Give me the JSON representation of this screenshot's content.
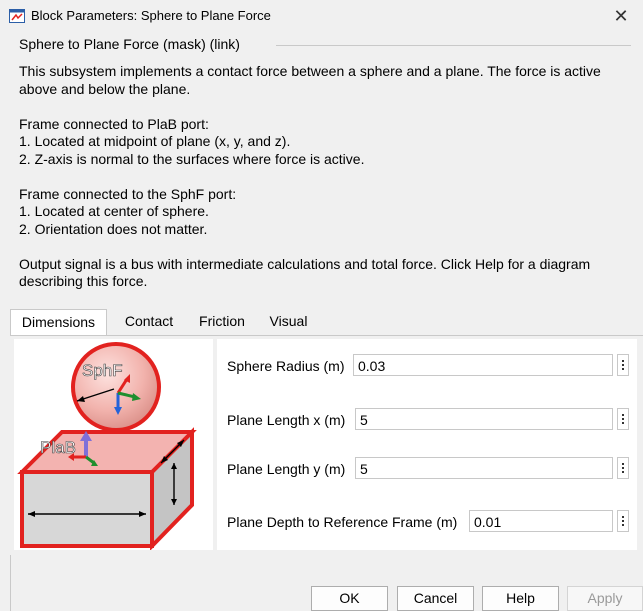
{
  "window": {
    "title": "Block Parameters: Sphere to Plane Force",
    "close_glyph": "✕"
  },
  "mask_header": "Sphere to Plane Force (mask) (link)",
  "description": [
    "This subsystem implements a contact force between a sphere and a plane.  The force is active above and below the plane.",
    "Frame connected to PlaB port:\n1. Located at midpoint of plane (x, y, and z).\n2. Z-axis is normal to the surfaces where force is active.",
    "Frame connected to the SphF port:\n1. Located at center of sphere.\n2. Orientation does not matter.",
    "Output signal is a bus with intermediate calculations and total force. Click Help for a diagram describing this force."
  ],
  "tabs": [
    {
      "label": "Dimensions",
      "active": true
    },
    {
      "label": "Contact",
      "active": false
    },
    {
      "label": "Friction",
      "active": false
    },
    {
      "label": "Visual",
      "active": false
    }
  ],
  "diagram": {
    "sphere_label": "SphF",
    "plane_label": "PlaB"
  },
  "params": [
    {
      "label": "Sphere Radius (m)",
      "value": "0.03"
    },
    {
      "label": "Plane Length x (m)",
      "value": "5"
    },
    {
      "label": "Plane Length y (m)",
      "value": "5"
    },
    {
      "label": "Plane Depth to Reference Frame (m)",
      "value": "0.01"
    }
  ],
  "buttons": {
    "ok": "OK",
    "cancel": "Cancel",
    "help": "Help",
    "apply": "Apply"
  },
  "colors": {
    "accent_red": "#e2221f",
    "sphere_fill": "#f2b3ad",
    "plane_top": "#f3b3b0",
    "plane_side": "#d7d7d7"
  }
}
